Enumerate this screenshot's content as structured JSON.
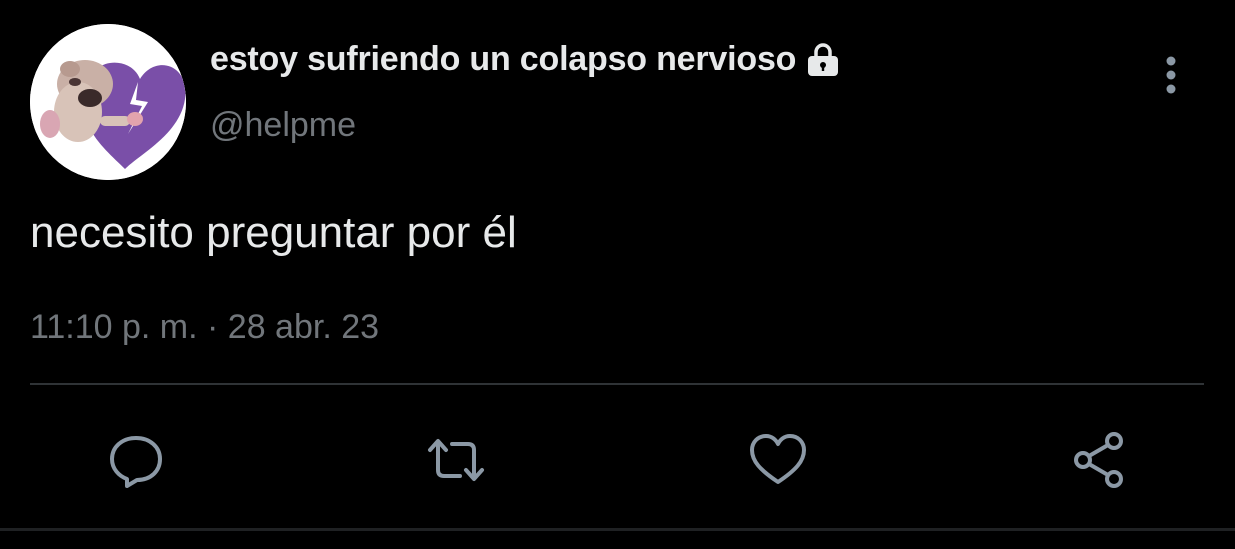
{
  "tweet": {
    "author": {
      "display_name": "estoy sufriendo un colapso nervioso",
      "handle": "@helpme",
      "protected_icon": "lock-icon",
      "avatar_icon": "avatar-image"
    },
    "text": "necesito preguntar por él",
    "timestamp": "11:10 p. m. · 28 abr. 23",
    "menu_icon": "more-vertical-icon"
  },
  "actions": [
    {
      "name": "reply",
      "icon": "reply-icon"
    },
    {
      "name": "retweet",
      "icon": "retweet-icon"
    },
    {
      "name": "like",
      "icon": "heart-icon"
    },
    {
      "name": "share",
      "icon": "share-icon"
    }
  ],
  "colors": {
    "background": "#000000",
    "primary_text": "#e7e9ea",
    "secondary_text": "#71767b",
    "divider": "#2f3336",
    "icon": "#8b98a5"
  }
}
